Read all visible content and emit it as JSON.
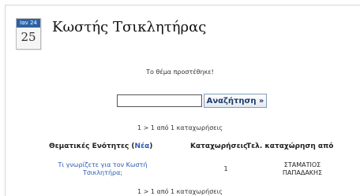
{
  "header": {
    "calendar": {
      "month": "Ιαν 24",
      "day": "25"
    },
    "title": "Κωστής Τσικλητήρας"
  },
  "message": "Το θέμα προστέθηκε!",
  "search": {
    "value": "",
    "button_label": "Αναζήτηση »"
  },
  "pagination_text": "1 > 1 από 1 καταχωρήσεις",
  "table": {
    "col1_label": "Θεματικές Ενότητες (",
    "col1_link": "Νέα",
    "col1_close": ")",
    "col2": "Καταχωρήσεις",
    "col3": "Τελ. καταχώρηση από",
    "rows": [
      {
        "topic_line1": "Τι γνωρίζετε για τον Κωστή",
        "topic_line2": "Τσικλητήρα;",
        "entries": "1",
        "last_by_line1": "ΣΤΑΜΑΤΙΟΣ",
        "last_by_line2": "ΠΑΠΑΔΑΚΗΣ"
      }
    ]
  },
  "colors": {
    "link": "#2d5bb3",
    "calendar_header": "#2b62a5"
  },
  "icons": {
    "calendar": "calendar-icon"
  }
}
